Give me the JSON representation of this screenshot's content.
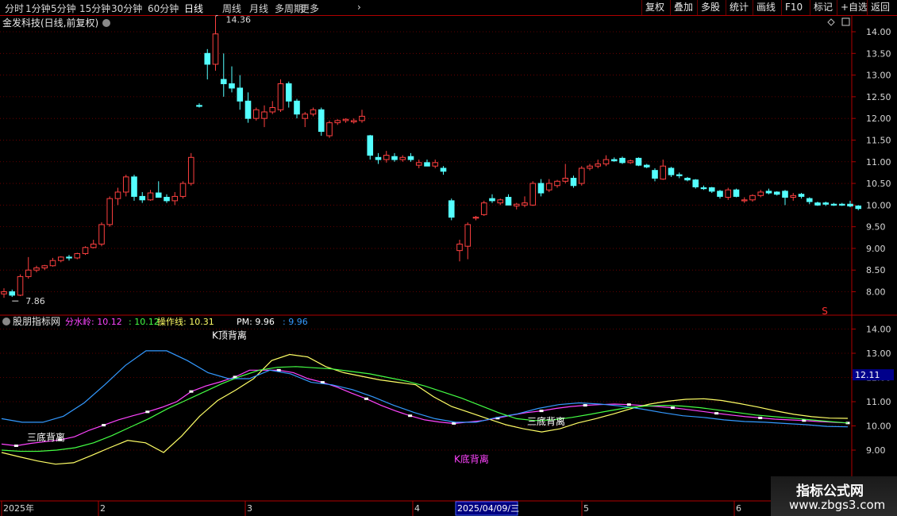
{
  "toolbar": {
    "periods": [
      "分时",
      "1分钟",
      "5分钟",
      "15分钟",
      "30分钟",
      "60分钟",
      "日线",
      "周线",
      "月线",
      "多周期",
      "更多"
    ],
    "active_period": "日线",
    "right_buttons": [
      "复权",
      "叠加",
      "多股",
      "统计",
      "画线",
      "F10",
      "标记",
      "+自选",
      "返回"
    ]
  },
  "main_chart": {
    "stock_title": "金发科技(日线,前复权)",
    "high_label": "14.36",
    "low_label": "7.86",
    "price_ticks": [
      "14.00",
      "13.50",
      "13.00",
      "12.50",
      "12.00",
      "11.50",
      "11.00",
      "10.50",
      "10.00",
      "9.50",
      "9.00",
      "8.50",
      "8.00"
    ],
    "s_marker": "S"
  },
  "indicator": {
    "name": "股朋指标网",
    "legend": [
      {
        "label": "分水岭: 10.12",
        "color": "#ff44ff"
      },
      {
        "label": ": 10.12",
        "color": "#44ff44"
      },
      {
        "label": "操作线: 10.31",
        "color": "#ffff66"
      },
      {
        "label": "PM: 9.96",
        "color": "#ffffff"
      },
      {
        "label": ": 9.96",
        "color": "#3399ff"
      }
    ],
    "ticks": [
      "14.00",
      "13.00",
      "12.00",
      "11.00",
      "10.00",
      "9.00"
    ],
    "current_badge": "12.11",
    "annotations": {
      "top_divergence": "K顶背离",
      "bottom_divergence_1": "三底背离",
      "bottom_divergence_2": "三底背离",
      "k_bottom": "K底背离"
    }
  },
  "date_axis": {
    "labels": [
      "2025年",
      "2",
      "3",
      "4",
      "5",
      "6"
    ],
    "cursor_date": "2025/04/09/三"
  },
  "watermark": {
    "line1": "指标公式网",
    "line2": "www.zbgs3.com"
  },
  "colors": {
    "up": "#ff4040",
    "down": "#54ffff",
    "axis": "#b00000",
    "grid": "#7a0000"
  },
  "chart_data": {
    "type": "candlestick",
    "candles": [
      [
        7.95,
        8.08,
        7.86,
        8.0
      ],
      [
        8.0,
        8.05,
        7.88,
        7.92
      ],
      [
        7.92,
        8.4,
        7.9,
        8.35
      ],
      [
        8.35,
        8.8,
        8.3,
        8.5
      ],
      [
        8.5,
        8.6,
        8.45,
        8.55
      ],
      [
        8.55,
        8.62,
        8.5,
        8.6
      ],
      [
        8.6,
        8.78,
        8.58,
        8.72
      ],
      [
        8.72,
        8.82,
        8.68,
        8.8
      ],
      [
        8.8,
        8.85,
        8.72,
        8.78
      ],
      [
        8.78,
        8.9,
        8.75,
        8.88
      ],
      [
        8.88,
        9.05,
        8.85,
        9.02
      ],
      [
        9.02,
        9.2,
        9.0,
        9.1
      ],
      [
        9.1,
        9.6,
        9.05,
        9.55
      ],
      [
        9.55,
        10.2,
        9.5,
        10.15
      ],
      [
        10.15,
        10.4,
        10.0,
        10.3
      ],
      [
        10.3,
        10.7,
        10.2,
        10.65
      ],
      [
        10.65,
        10.7,
        10.1,
        10.2
      ],
      [
        10.2,
        10.3,
        10.05,
        10.12
      ],
      [
        10.12,
        10.35,
        10.1,
        10.28
      ],
      [
        10.28,
        10.55,
        10.2,
        10.18
      ],
      [
        10.18,
        10.25,
        10.05,
        10.1
      ],
      [
        10.1,
        10.3,
        10.0,
        10.2
      ],
      [
        10.2,
        10.55,
        10.15,
        10.5
      ],
      [
        10.5,
        11.2,
        10.45,
        11.1
      ],
      [
        12.3,
        12.35,
        12.25,
        12.28
      ],
      [
        13.5,
        13.6,
        12.9,
        13.25
      ],
      [
        13.25,
        14.36,
        13.1,
        13.95
      ],
      [
        12.9,
        13.5,
        12.5,
        12.8
      ],
      [
        12.8,
        13.2,
        12.6,
        12.7
      ],
      [
        12.7,
        13.0,
        12.2,
        12.4
      ],
      [
        12.4,
        12.6,
        11.9,
        12.0
      ],
      [
        12.0,
        12.25,
        11.95,
        12.2
      ],
      [
        12.0,
        12.3,
        11.8,
        12.15
      ],
      [
        12.15,
        12.4,
        12.1,
        12.25
      ],
      [
        12.2,
        12.9,
        12.15,
        12.8
      ],
      [
        12.8,
        12.85,
        12.25,
        12.4
      ],
      [
        12.4,
        12.45,
        12.0,
        12.1
      ],
      [
        12.0,
        12.15,
        11.8,
        12.1
      ],
      [
        12.1,
        12.25,
        12.05,
        12.2
      ],
      [
        12.2,
        12.25,
        11.6,
        11.7
      ],
      [
        11.6,
        11.95,
        11.55,
        11.9
      ],
      [
        11.9,
        11.98,
        11.85,
        11.95
      ],
      [
        11.95,
        12.0,
        11.9,
        11.98
      ],
      [
        11.92,
        12.0,
        11.88,
        11.95
      ],
      [
        11.95,
        12.2,
        11.9,
        12.05
      ],
      [
        11.6,
        11.62,
        11.05,
        11.15
      ],
      [
        11.1,
        11.2,
        10.95,
        11.05
      ],
      [
        11.05,
        11.25,
        10.98,
        11.15
      ],
      [
        11.12,
        11.2,
        11.0,
        11.05
      ],
      [
        11.05,
        11.15,
        11.0,
        11.1
      ],
      [
        11.12,
        11.2,
        11.0,
        11.05
      ],
      [
        10.92,
        11.05,
        10.85,
        10.98
      ],
      [
        10.98,
        11.05,
        10.9,
        10.9
      ],
      [
        10.9,
        11.05,
        10.85,
        10.98
      ],
      [
        10.85,
        10.9,
        10.7,
        10.78
      ],
      [
        10.1,
        10.15,
        9.65,
        9.72
      ],
      [
        8.95,
        9.2,
        8.7,
        9.1
      ],
      [
        9.05,
        9.6,
        8.75,
        9.55
      ],
      [
        9.7,
        9.75,
        9.65,
        9.72
      ],
      [
        9.78,
        10.1,
        9.75,
        10.05
      ],
      [
        10.15,
        10.25,
        10.05,
        10.1
      ],
      [
        10.05,
        10.15,
        10.0,
        10.12
      ],
      [
        10.18,
        10.25,
        10.05,
        10.0
      ],
      [
        9.98,
        10.05,
        9.9,
        10.02
      ],
      [
        10.0,
        10.2,
        9.95,
        10.05
      ],
      [
        10.0,
        10.55,
        9.98,
        10.5
      ],
      [
        10.5,
        10.6,
        10.2,
        10.28
      ],
      [
        10.35,
        10.6,
        10.3,
        10.5
      ],
      [
        10.45,
        10.58,
        10.4,
        10.55
      ],
      [
        10.55,
        10.95,
        10.5,
        10.62
      ],
      [
        10.62,
        10.68,
        10.4,
        10.45
      ],
      [
        10.5,
        10.9,
        10.45,
        10.85
      ],
      [
        10.85,
        10.95,
        10.8,
        10.9
      ],
      [
        10.9,
        11.05,
        10.85,
        10.95
      ],
      [
        10.95,
        11.15,
        10.9,
        11.05
      ],
      [
        11.05,
        11.1,
        11.0,
        11.02
      ],
      [
        11.08,
        11.12,
        10.95,
        10.98
      ],
      [
        10.98,
        11.05,
        10.95,
        11.02
      ],
      [
        11.08,
        11.1,
        10.9,
        10.92
      ],
      [
        10.92,
        10.95,
        10.85,
        10.88
      ],
      [
        10.8,
        10.85,
        10.55,
        10.62
      ],
      [
        10.6,
        11.05,
        10.58,
        10.9
      ],
      [
        10.85,
        10.88,
        10.65,
        10.7
      ],
      [
        10.7,
        10.75,
        10.62,
        10.68
      ],
      [
        10.62,
        10.65,
        10.55,
        10.58
      ],
      [
        10.58,
        10.6,
        10.38,
        10.42
      ],
      [
        10.4,
        10.45,
        10.35,
        10.38
      ],
      [
        10.4,
        10.42,
        10.28,
        10.32
      ],
      [
        10.32,
        10.35,
        10.15,
        10.2
      ],
      [
        10.18,
        10.4,
        10.12,
        10.35
      ],
      [
        10.35,
        10.38,
        10.18,
        10.2
      ],
      [
        10.1,
        10.18,
        10.05,
        10.12
      ],
      [
        10.12,
        10.25,
        10.08,
        10.22
      ],
      [
        10.22,
        10.35,
        10.18,
        10.3
      ],
      [
        10.32,
        10.38,
        10.25,
        10.28
      ],
      [
        10.3,
        10.32,
        10.22,
        10.25
      ],
      [
        10.32,
        10.35,
        10.0,
        10.18
      ],
      [
        10.18,
        10.28,
        10.1,
        10.22
      ],
      [
        10.25,
        10.28,
        10.15,
        10.2
      ],
      [
        10.15,
        10.18,
        10.02,
        10.08
      ],
      [
        10.05,
        10.08,
        9.98,
        10.0
      ],
      [
        10.05,
        10.08,
        9.98,
        10.02
      ],
      [
        10.02,
        10.05,
        9.98,
        10.0
      ],
      [
        10.02,
        10.05,
        9.98,
        10.0
      ],
      [
        10.02,
        10.1,
        9.95,
        9.98
      ],
      [
        9.98,
        10.0,
        9.88,
        9.92
      ]
    ],
    "indicator_series": [
      {
        "label": "分水岭",
        "color": "#ff44ff",
        "values": [
          9.25,
          9.18,
          9.28,
          9.35,
          9.42,
          9.55,
          9.82,
          10.03,
          10.25,
          10.42,
          10.58,
          10.77,
          11.0,
          11.42,
          11.65,
          11.82,
          12.02,
          12.3,
          12.3,
          12.3,
          12.2,
          11.95,
          11.8,
          11.6,
          11.35,
          11.12,
          10.85,
          10.62,
          10.42,
          10.25,
          10.16,
          10.1,
          10.16,
          10.22,
          10.32,
          10.45,
          10.55,
          10.62,
          10.72,
          10.8,
          10.85,
          10.88,
          10.9,
          10.88,
          10.84,
          10.8,
          10.75,
          10.68,
          10.6,
          10.52,
          10.45,
          10.38,
          10.33,
          10.28,
          10.25,
          10.22,
          10.18,
          10.15,
          10.12
        ]
      },
      {
        "label": "操作线",
        "color": "#ffff66",
        "values": [
          8.9,
          8.72,
          8.55,
          8.42,
          8.48,
          8.78,
          9.1,
          9.4,
          9.3,
          8.9,
          9.58,
          10.4,
          11.05,
          11.48,
          11.95,
          12.7,
          12.95,
          12.85,
          12.45,
          12.2,
          12.05,
          11.9,
          11.8,
          11.7,
          11.2,
          10.8,
          10.55,
          10.3,
          10.05,
          9.88,
          9.75,
          9.88,
          10.12,
          10.3,
          10.5,
          10.72,
          10.9,
          11.02,
          11.1,
          11.12,
          11.05,
          10.92,
          10.78,
          10.62,
          10.48,
          10.38,
          10.32,
          10.31
        ]
      },
      {
        "label": "PM",
        "color": "#3399ff",
        "values": [
          10.3,
          10.15,
          10.15,
          10.4,
          10.95,
          11.7,
          12.5,
          13.1,
          13.1,
          12.7,
          12.2,
          11.95,
          11.95,
          12.3,
          12.15,
          11.8,
          11.7,
          11.5,
          11.2,
          10.85,
          10.55,
          10.3,
          10.15,
          10.15,
          10.35,
          10.5,
          10.72,
          10.88,
          10.95,
          10.9,
          10.82,
          10.7,
          10.55,
          10.42,
          10.35,
          10.25,
          10.18,
          10.15,
          10.1,
          10.05,
          9.98,
          9.96
        ]
      },
      {
        "label": "",
        "color": "#44ff44",
        "values": [
          9.0,
          8.95,
          8.95,
          9.0,
          9.1,
          9.3,
          9.6,
          9.95,
          10.3,
          10.7,
          11.05,
          11.4,
          11.75,
          12.05,
          12.3,
          12.42,
          12.45,
          12.4,
          12.35,
          12.25,
          12.15,
          12.0,
          11.85,
          11.65,
          11.4,
          11.15,
          10.85,
          10.55,
          10.3,
          10.22,
          10.25,
          10.35,
          10.48,
          10.62,
          10.75,
          10.82,
          10.85,
          10.82,
          10.75,
          10.65,
          10.55,
          10.45,
          10.38,
          10.32,
          10.25,
          10.18,
          10.12
        ]
      }
    ]
  }
}
